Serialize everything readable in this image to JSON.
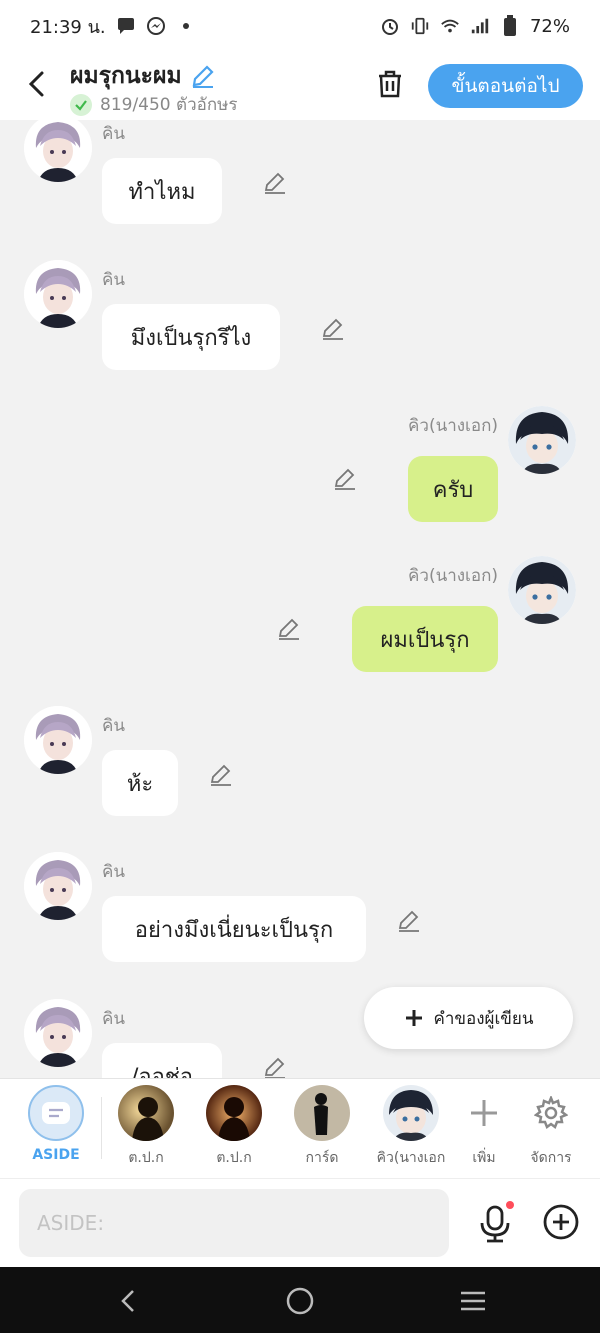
{
  "status_bar": {
    "time": "21:39 น.",
    "battery": "72%",
    "icons": [
      "chat-bubble-icon",
      "messenger-icon",
      "dot-icon",
      "alarm-icon",
      "vibrate-icon",
      "wifi-icon",
      "signal-icon",
      "battery-icon"
    ]
  },
  "header": {
    "title": "ผมรุกนะผม",
    "char_count": "819/450 ตัวอักษร",
    "next_button": "ขั้นตอนต่อไป"
  },
  "messages": [
    {
      "side": "left",
      "name": "คิน",
      "text": "ทำไหม"
    },
    {
      "side": "left",
      "name": "คิน",
      "text": "มึงเป็นรุกรึไง"
    },
    {
      "side": "right",
      "name": "คิว(นางเอก)",
      "text": "ครับ"
    },
    {
      "side": "right",
      "name": "คิว(นางเอก)",
      "text": "ผมเป็นรุก"
    },
    {
      "side": "left",
      "name": "คิน",
      "text": "ห้ะ"
    },
    {
      "side": "left",
      "name": "คิน",
      "text": "อย่างมึงเนี่ยนะเป็นรุก"
    },
    {
      "side": "left",
      "name": "คิน",
      "text": "/ออช่อ"
    }
  ],
  "writer_note_button": "คำของผู้เขียน",
  "character_bar": {
    "items": [
      {
        "label": "ASIDE",
        "selected": true
      },
      {
        "label": "ต.ป.ก"
      },
      {
        "label": "ต.ป.ก"
      },
      {
        "label": "การ์ด"
      },
      {
        "label": "คิว(นางเอก"
      },
      {
        "label": "เพิ่ม"
      },
      {
        "label": "จัดการ"
      }
    ]
  },
  "input": {
    "placeholder": "ASIDE:"
  },
  "colors": {
    "accent": "#4aa3ef",
    "green_bubble": "#d7f08b",
    "background": "#f2f2f2"
  }
}
